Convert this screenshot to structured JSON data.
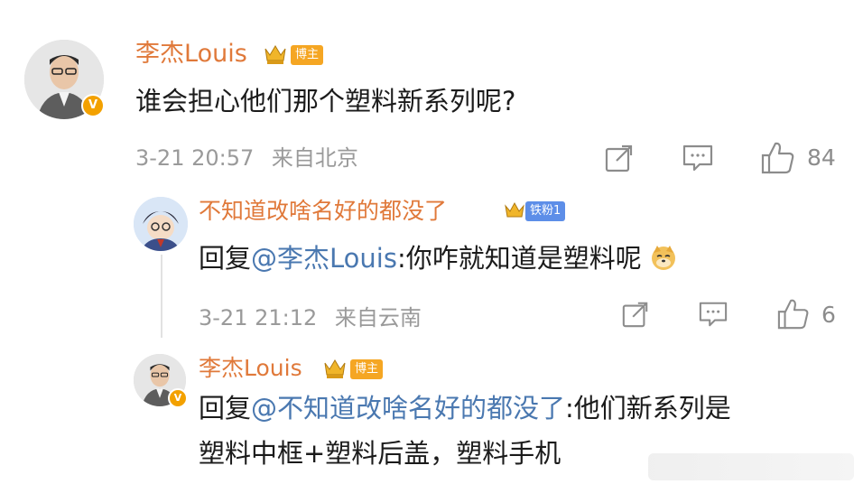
{
  "comments": [
    {
      "username": "李杰Louis",
      "badge": "博主",
      "verified": "V",
      "content": "谁会担心他们那个塑料新系列呢?",
      "timestamp": "3-21 20:57",
      "location": "来自北京",
      "likes": "84"
    },
    {
      "username": "不知道改啥名好的都没了",
      "badge": "铁粉1",
      "reply_prefix": "回复",
      "mention": "@李杰Louis",
      "text": ":你咋就知道是塑料呢",
      "emoji": "doge-emoji",
      "timestamp": "3-21 21:12",
      "location": "来自云南",
      "likes": "6"
    },
    {
      "username": "李杰Louis",
      "badge": "博主",
      "verified": "V",
      "reply_prefix": "回复",
      "mention": "@不知道改啥名好的都没了",
      "text_line1": ":他们新系列是",
      "text_line2": "塑料中框+塑料后盖，塑料手机"
    }
  ],
  "colors": {
    "username": "#e0793a",
    "mention": "#4a78b0",
    "meta": "#9a9a9a",
    "blogger_badge": "#f5a623",
    "fan_badge": "#5d8ee8"
  }
}
